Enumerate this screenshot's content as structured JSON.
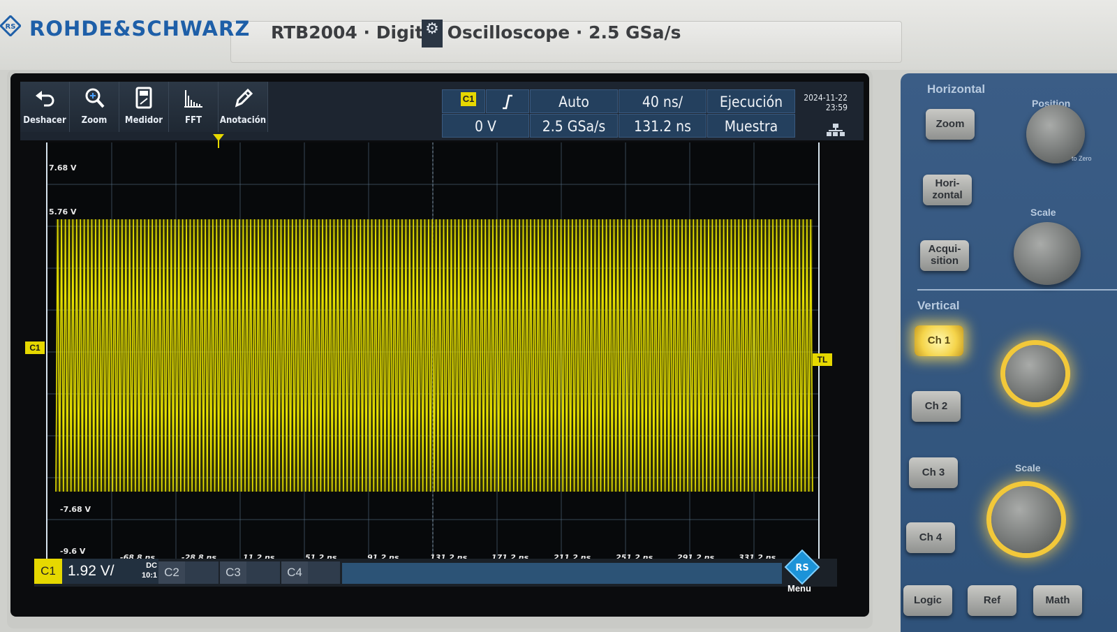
{
  "brand": {
    "name": "ROHDE&SCHWARZ",
    "model": "RTB2004 · Digital Oscilloscope · 2.5 GSa/s"
  },
  "toolbar": {
    "tools": [
      {
        "label": "Deshacer",
        "icon": "undo-icon"
      },
      {
        "label": "Zoom",
        "icon": "zoom-icon"
      },
      {
        "label": "Medidor",
        "icon": "meter-icon"
      },
      {
        "label": "FFT",
        "icon": "fft-icon"
      },
      {
        "label": "Anotación",
        "icon": "pencil-icon"
      }
    ],
    "trigger_source": "C1",
    "trigger_slope_icon": "rising-edge-icon",
    "trigger_mode": "Auto",
    "trigger_level": "0 V",
    "sample_rate": "2.5 GSa/s",
    "time_scale": "40 ns/",
    "time_offset": "131.2 ns",
    "run_state": "Ejecución",
    "acq_mode": "Muestra",
    "date": "2024-11-22",
    "time": "23:59"
  },
  "plot": {
    "y_labels": [
      "7.68 V",
      "5.76 V",
      "-7.68 V",
      "-9.6 V"
    ],
    "x_labels": [
      "-68.8 ns",
      "-28.8 ns",
      "11.2 ns",
      "51.2 ns",
      "91.2 ns",
      "131.2 ns",
      "171.2 ns",
      "211.2 ns",
      "251.2 ns",
      "291.2 ns",
      "331.2 ns"
    ],
    "channel_marker": "C1",
    "trigger_marker": "TL",
    "trace_color": "#e6e000"
  },
  "channels": {
    "ch1_tag": "C1",
    "ch1_scale": "1.92 V/",
    "ch1_coupling": "DC",
    "ch1_probe": "10:1",
    "others": [
      "C2",
      "C3",
      "C4"
    ],
    "menu_label": "Menu"
  },
  "panel": {
    "horizontal_title": "Horizontal",
    "position_label": "Position",
    "scale_label": "Scale",
    "vertical_title": "Vertical",
    "vscale_label": "Scale",
    "to_zero": "to Zero",
    "buttons": {
      "zoom": "Zoom",
      "horizontal_a": "Hori-",
      "horizontal_b": "zontal",
      "acq_a": "Acqui-",
      "acq_b": "sition",
      "ch1": "Ch 1",
      "ch2": "Ch 2",
      "ch3": "Ch 3",
      "ch4": "Ch 4",
      "logic": "Logic",
      "ref": "Ref",
      "math": "Math"
    }
  }
}
